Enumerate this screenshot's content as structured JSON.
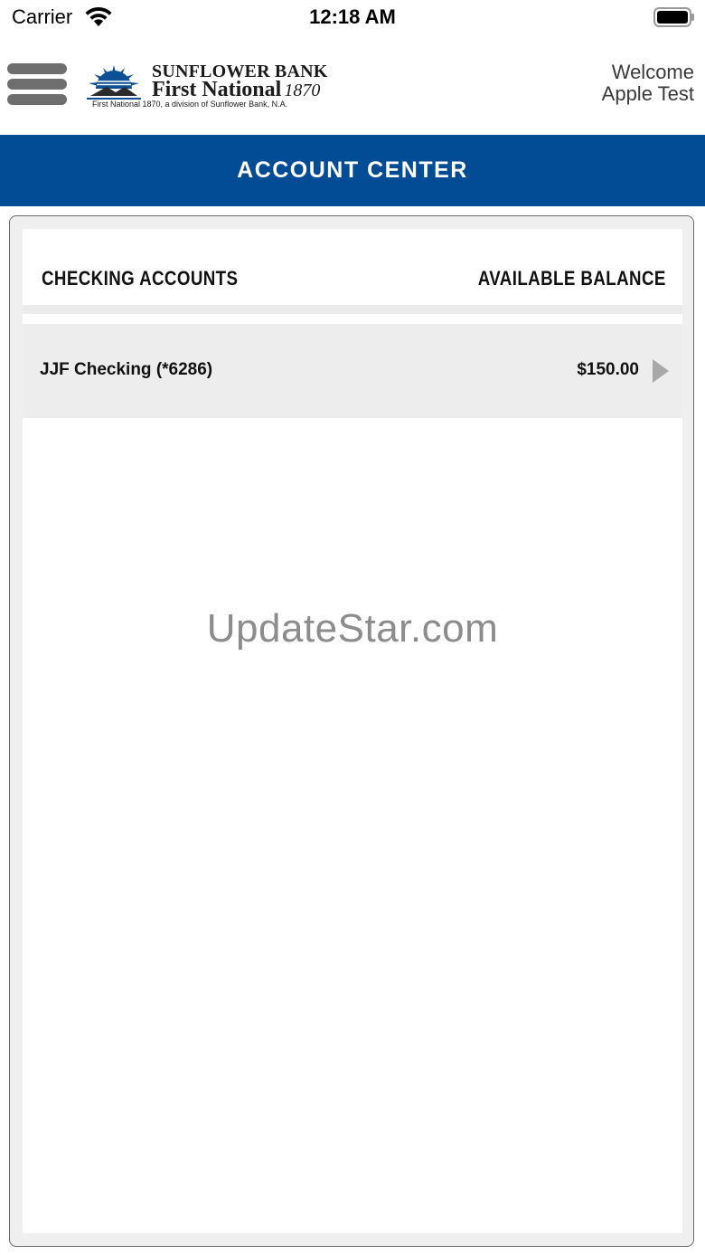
{
  "status_bar": {
    "carrier": "Carrier",
    "time": "12:18 AM"
  },
  "header": {
    "logo": {
      "line1": "SUNFLOWER BANK",
      "line2": "First National",
      "year": "1870",
      "tagline": "First National 1870, a division of Sunflower Bank, N.A."
    },
    "welcome_line1": "Welcome",
    "welcome_line2": "Apple Test"
  },
  "title_bar": {
    "title": "ACCOUNT CENTER",
    "background_color": "#024c96"
  },
  "accounts_section": {
    "left_header": "CHECKING ACCOUNTS",
    "right_header": "AVAILABLE BALANCE",
    "accounts": [
      {
        "name": "JJF Checking (*6286)",
        "balance": "$150.00",
        "icon": "chevron-right-icon"
      }
    ]
  },
  "watermark": "UpdateStar.com"
}
